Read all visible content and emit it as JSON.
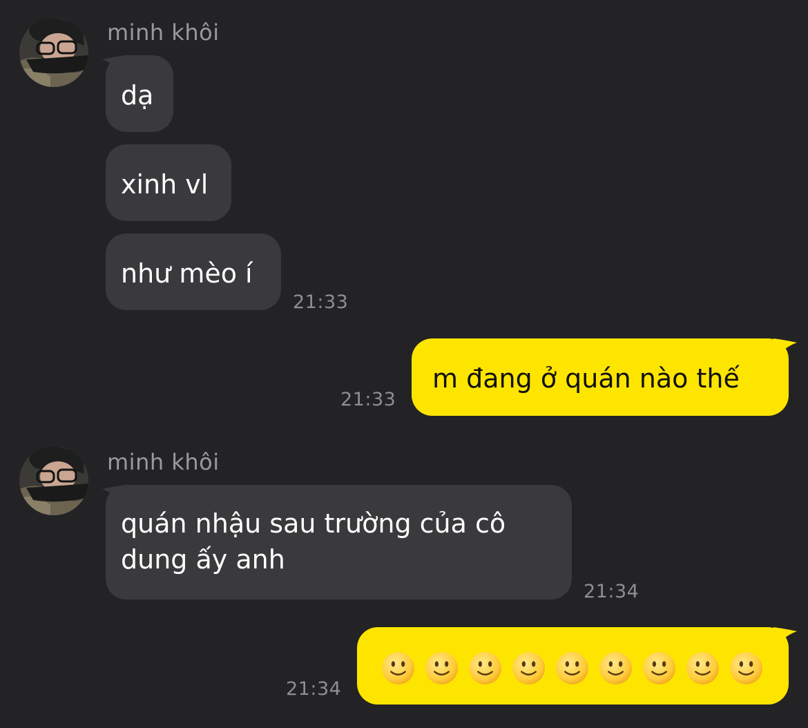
{
  "conversation": {
    "groups": [
      {
        "sender": "minh khôi",
        "messages": [
          "dạ",
          "xinh vl",
          "như mèo í"
        ],
        "time": "21:33"
      },
      {
        "outgoing": "m đang ở quán nào thế",
        "time": "21:33"
      },
      {
        "sender": "minh khôi",
        "messages": [
          "quán nhậu sau trường của cô dung ấy anh"
        ],
        "time": "21:34"
      },
      {
        "outgoing_emoji": [
          "🙂",
          "🙂",
          "🙂",
          "🙂",
          "🙂",
          "🙂",
          "🙂",
          "🙂",
          "🙂"
        ],
        "emoji_icon": "slightly-smiling-face-icon",
        "time": "21:34"
      }
    ]
  },
  "colors": {
    "background": "#232326",
    "incoming_bubble": "#3a3a3d",
    "outgoing_bubble": "#fee500",
    "timestamp": "#8e8e93",
    "sender_name": "#9a9a9e"
  }
}
